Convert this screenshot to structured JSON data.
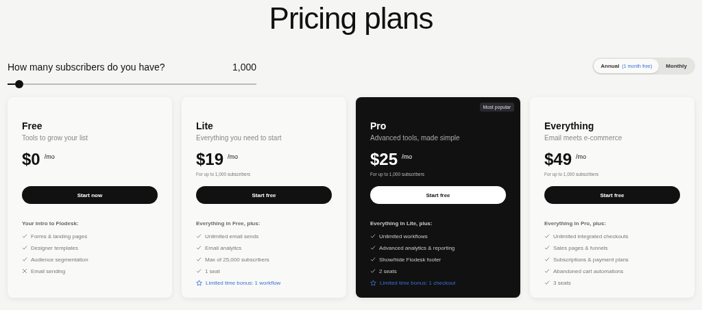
{
  "title": "Pricing plans",
  "slider": {
    "label": "How many subscribers do you have?",
    "value": "1,000",
    "level": 0.03
  },
  "billing_toggle": [
    {
      "label": "Annual",
      "note": "(1 month free)",
      "selected": true
    },
    {
      "label": "Monthly",
      "selected": false
    }
  ],
  "plans": [
    {
      "name": "Free",
      "tagline": "Tools to grow your list",
      "price": "$0",
      "period": "/mo",
      "dark": false,
      "button": "Start now",
      "features_heading": "Your intro to Flodesk:",
      "features": [
        {
          "kind": "check",
          "text": "Forms & landing pages"
        },
        {
          "kind": "check",
          "text": "Designer templates"
        },
        {
          "kind": "check",
          "text": "Audience segmentation"
        },
        {
          "kind": "cross",
          "text": "Email sending"
        }
      ]
    },
    {
      "name": "Lite",
      "tagline": "Everything you need to start",
      "price": "$19",
      "period": "/mo",
      "note": "For up to 1,000 subscribers",
      "dark": false,
      "button": "Start free",
      "features_heading": "Everything in Free, plus:",
      "features": [
        {
          "kind": "check",
          "text": "Unlimited email sends"
        },
        {
          "kind": "check",
          "text": "Email analytics"
        },
        {
          "kind": "check",
          "text": "Max of 25,000 subscribers"
        },
        {
          "kind": "check",
          "text": "1 seat"
        },
        {
          "kind": "bonus",
          "text": "Limited time bonus: 1 workflow"
        }
      ]
    },
    {
      "name": "Pro",
      "badge": "Most popular",
      "tagline": "Advanced tools, made simple",
      "price": "$25",
      "period": "/mo",
      "note": "For up to 1,000 subscribers",
      "dark": true,
      "button": "Start free",
      "features_heading": "Everything in Lite, plus:",
      "features": [
        {
          "kind": "check",
          "text": "Unlimited workflows"
        },
        {
          "kind": "check",
          "text": "Advanced analytics & reporting"
        },
        {
          "kind": "check",
          "text": "Show/hide Flodesk footer"
        },
        {
          "kind": "check",
          "text": "2 seats"
        },
        {
          "kind": "bonus",
          "text": "Limited time bonus: 1 checkout"
        }
      ]
    },
    {
      "name": "Everything",
      "tagline": "Email meets e-commerce",
      "price": "$49",
      "period": "/mo",
      "note": "For up to 1,000 subscribers",
      "dark": false,
      "button": "Start free",
      "features_heading": "Everything in Pro, plus:",
      "features": [
        {
          "kind": "check",
          "text": "Unlimited integrated checkouts"
        },
        {
          "kind": "check",
          "text": "Sales pages & funnels"
        },
        {
          "kind": "check",
          "text": "Subscriptions & payment plans"
        },
        {
          "kind": "check",
          "text": "Abandoned cart automations"
        },
        {
          "kind": "check",
          "text": "3 seats"
        }
      ]
    }
  ]
}
